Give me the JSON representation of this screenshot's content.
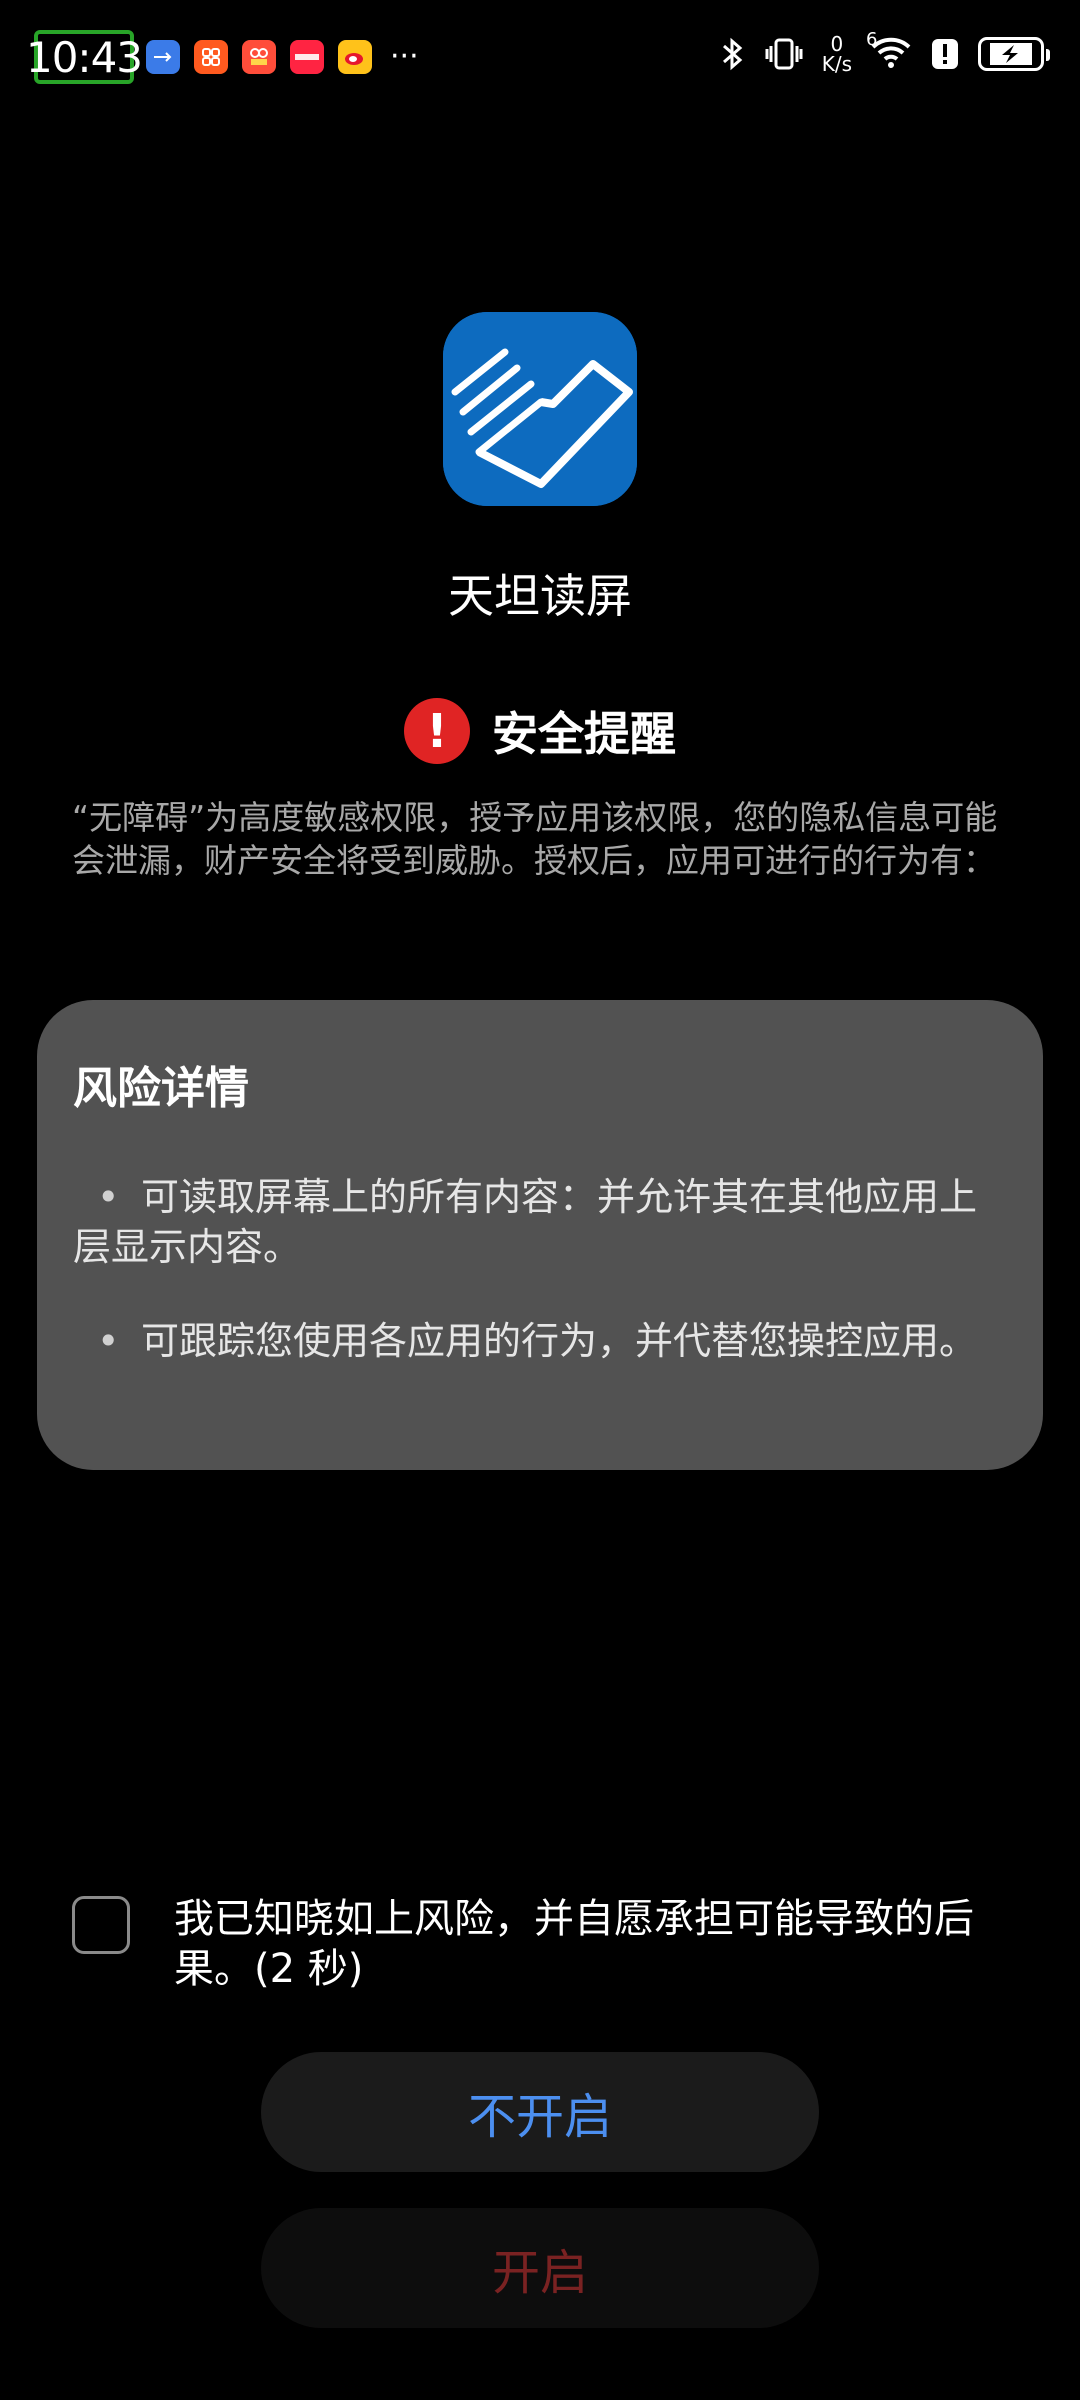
{
  "status_bar": {
    "time": "10:43",
    "notification_icons": [
      "usb-icon",
      "taobao-icon",
      "shop-icon",
      "xiaohongshu-icon",
      "weibo-icon"
    ],
    "more": "···",
    "net_speed_value": "0",
    "net_speed_unit": "K/s",
    "signal": "6",
    "icons": [
      "bluetooth-icon",
      "vibrate-icon",
      "wifi-icon",
      "alert-icon",
      "battery-charging-icon"
    ]
  },
  "app": {
    "name": "天坦读屏",
    "icon_color": "#0d6bbf"
  },
  "warning": {
    "icon_symbol": "!",
    "title": "安全提醒",
    "description": "“无障碍”为高度敏感权限，授予应用该权限，您的隐私信息可能会泄漏，财产安全将受到威胁。授权后，应用可进行的行为有："
  },
  "risk": {
    "title": "风险详情",
    "items": [
      "可读取屏幕上的所有内容：并允许其在其他应用上层显示内容。",
      "可跟踪您使用各应用的行为，并代替您操控应用。"
    ],
    "bullet": "•"
  },
  "consent": {
    "text": "我已知晓如上风险，并自愿承担可能导致的后果。(2 秒)",
    "checked": false
  },
  "buttons": {
    "deny_label": "不开启",
    "allow_label": "开启",
    "deny_color": "#4c8ff0",
    "allow_color": "#7a2222"
  }
}
